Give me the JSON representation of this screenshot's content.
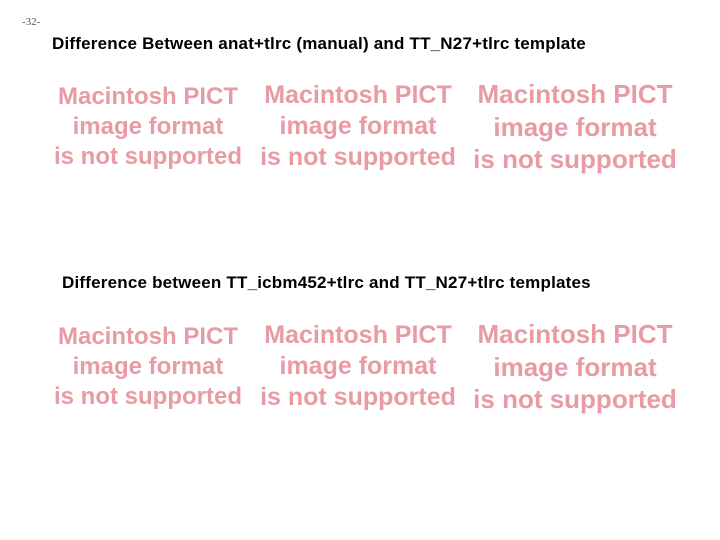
{
  "page_number": "-32-",
  "heading1": {
    "prefix": "Difference Between ",
    "var1": "anat+tlrc",
    "mid": " (manual) and ",
    "var2": "TT_N27+tlrc",
    "suffix": " template"
  },
  "heading2": {
    "prefix": "Difference between ",
    "var1": "TT_icbm452+tlrc",
    "mid": " and ",
    "var2": "TT_N27+tlrc",
    "suffix": " templates"
  },
  "pict_placeholder": {
    "line1": "Macintosh PICT",
    "line2": "image format",
    "line3": "is not supported"
  }
}
